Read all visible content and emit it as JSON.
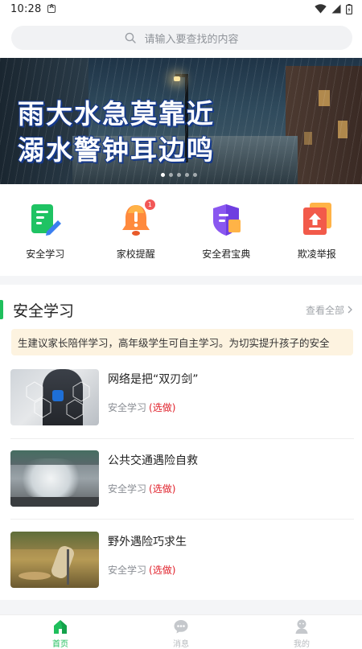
{
  "status_bar": {
    "time": "10:28"
  },
  "search": {
    "placeholder": "请输入要查找的内容"
  },
  "banner": {
    "line1": "雨大水急莫靠近",
    "line2": "溺水警钟耳边鸣",
    "slide_count": 5,
    "active_slide": 1
  },
  "menu": [
    {
      "label": "安全学习",
      "icon": "study-doc-icon"
    },
    {
      "label": "家校提醒",
      "icon": "bell-icon",
      "badge": "1"
    },
    {
      "label": "安全君宝典",
      "icon": "shield-book-icon"
    },
    {
      "label": "欺凌举报",
      "icon": "report-upload-icon"
    }
  ],
  "section": {
    "title": "安全学习",
    "more": "查看全部",
    "notice": "生建议家长陪伴学习，高年级学生可自主学习。为切实提升孩子的安全",
    "items": [
      {
        "title": "网络是把“双刃剑”",
        "meta": "安全学习",
        "tag": "(选做)"
      },
      {
        "title": "公共交通遇险自救",
        "meta": "安全学习",
        "tag": "(选做)"
      },
      {
        "title": "野外遇险巧求生",
        "meta": "安全学习",
        "tag": "(选做)"
      }
    ]
  },
  "tabbar": [
    {
      "label": "首页",
      "active": true
    },
    {
      "label": "消息",
      "active": false
    },
    {
      "label": "我的",
      "active": false
    }
  ],
  "colors": {
    "accent": "#1fbf5c",
    "tag": "#e0202a",
    "notice_bg": "#fdf3e0"
  }
}
